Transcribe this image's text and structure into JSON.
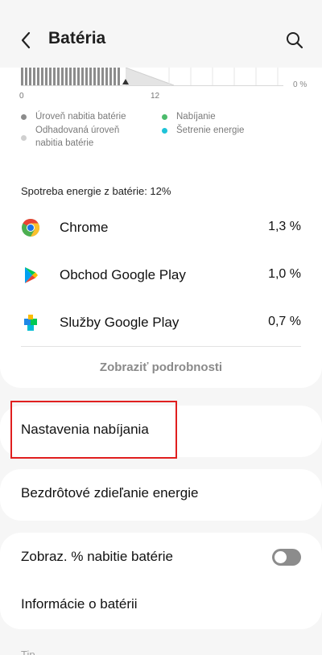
{
  "header": {
    "title": "Batéria"
  },
  "chart": {
    "tick_start": "0",
    "tick_mid": "12",
    "right_pct_label": "0 %",
    "legend": [
      {
        "label": "Úroveň nabitia batérie",
        "color": "#8c8c8c"
      },
      {
        "label": "Odhadovaná úroveň nabitia batérie",
        "color": "#d0d0d0"
      },
      {
        "label": "Nabíjanie",
        "color": "#4cbb6c"
      },
      {
        "label": "Šetrenie energie",
        "color": "#1fc3d8"
      }
    ]
  },
  "usage": {
    "title": "Spotreba energie z batérie: 12%",
    "apps": [
      {
        "name": "Chrome",
        "percent": "1,3 %",
        "icon": "chrome-icon"
      },
      {
        "name": "Obchod Google Play",
        "percent": "1,0 %",
        "icon": "google-play-store-icon"
      },
      {
        "name": "Služby Google Play",
        "percent": "0,7 %",
        "icon": "google-play-services-icon"
      }
    ],
    "details_label": "Zobraziť podrobnosti"
  },
  "settings": {
    "charging_settings": "Nastavenia nabíjania",
    "wireless_power_sharing": "Bezdrôtové zdieľanie energie",
    "show_battery_percent": "Zobraz. % nabitie batérie",
    "show_battery_percent_enabled": false,
    "battery_info": "Informácie o batérii"
  },
  "footer": {
    "tip_label": "Tip"
  }
}
